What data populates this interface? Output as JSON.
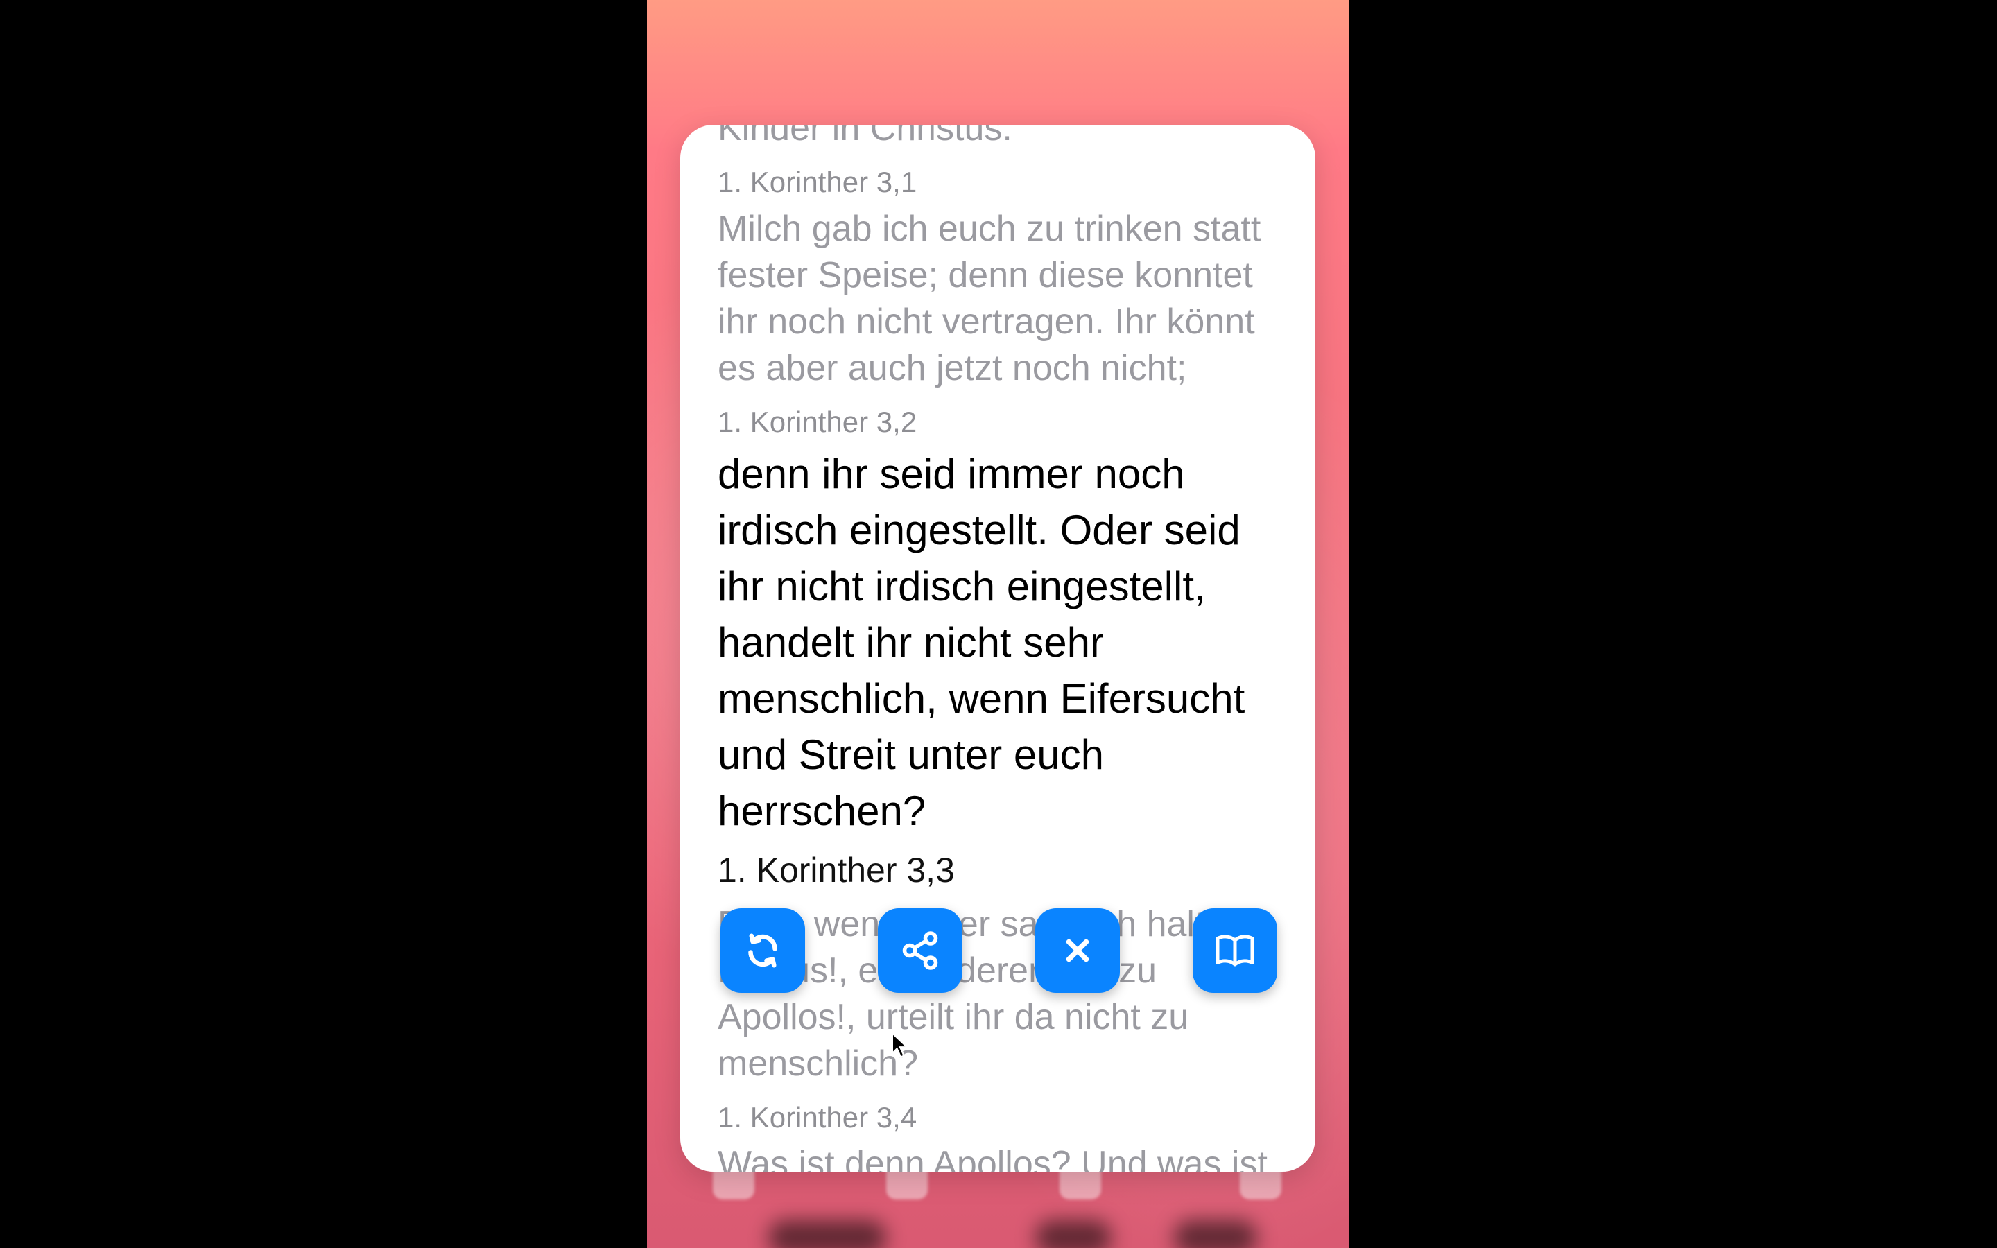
{
  "colors": {
    "accent": "#0a84ff",
    "card_background": "#ffffff",
    "active_text": "#000000",
    "muted_text": "#9a9aa0"
  },
  "verses": [
    {
      "text": "Kinder in Christus.",
      "ref": "1. Korinther 3,1",
      "active": false
    },
    {
      "text": "Milch gab ich euch zu trinken statt fester Speise; denn diese konntet ihr noch nicht vertragen. Ihr könnt es aber auch jetzt noch nicht;",
      "ref": "1. Korinther 3,2",
      "active": false
    },
    {
      "text": "denn ihr seid immer noch irdisch eingestellt. Oder seid ihr nicht irdisch eingestellt, handelt ihr nicht sehr menschlich, wenn Eifersucht und Streit unter euch herrschen?",
      "ref": "1. Korinther 3,3",
      "active": true
    },
    {
      "text": "Denn wenn einer sagt: Ich halte zu Paulus!, ein anderer: Ich zu Apollos!, urteilt ihr da nicht zu menschlich?",
      "ref": "1. Korinther 3,4",
      "active": false
    },
    {
      "text": "Was ist denn Apollos? Und was ist Paulus? Diener, durch die ihr zum",
      "ref": "",
      "active": false
    }
  ],
  "actions": [
    {
      "name": "refresh-button",
      "icon": "refresh-icon"
    },
    {
      "name": "share-button",
      "icon": "share-icon"
    },
    {
      "name": "close-button",
      "icon": "close-icon"
    },
    {
      "name": "open-bible-button",
      "icon": "book-icon"
    }
  ]
}
